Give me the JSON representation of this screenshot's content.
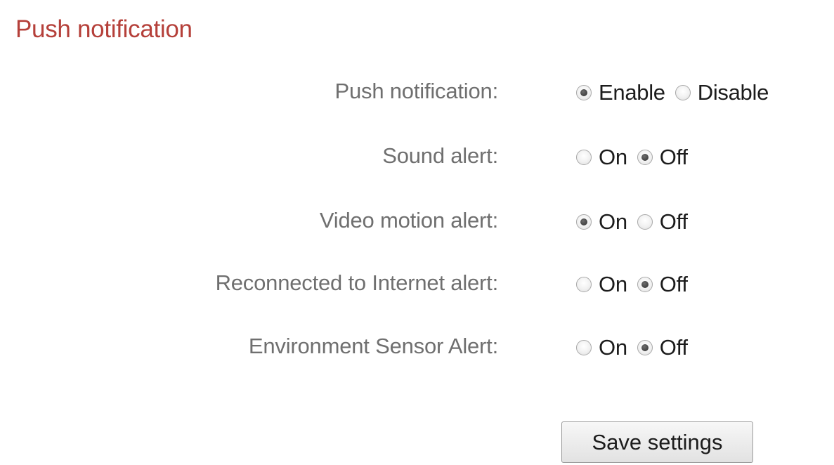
{
  "section_title": "Push notification",
  "settings": [
    {
      "label": "Push notification:",
      "options": [
        {
          "label": "Enable",
          "checked": true
        },
        {
          "label": "Disable",
          "checked": false
        }
      ]
    },
    {
      "label": "Sound alert:",
      "options": [
        {
          "label": "On",
          "checked": false
        },
        {
          "label": "Off",
          "checked": true
        }
      ]
    },
    {
      "label": "Video motion alert:",
      "options": [
        {
          "label": "On",
          "checked": true
        },
        {
          "label": "Off",
          "checked": false
        }
      ]
    },
    {
      "label": "Reconnected to Internet alert:",
      "options": [
        {
          "label": "On",
          "checked": false
        },
        {
          "label": "Off",
          "checked": true
        }
      ]
    },
    {
      "label": "Environment Sensor Alert:",
      "options": [
        {
          "label": "On",
          "checked": false
        },
        {
          "label": "Off",
          "checked": true
        }
      ]
    }
  ],
  "save_button_label": "Save settings",
  "colors": {
    "title": "#b5403a",
    "label": "#6f6f6f",
    "text": "#1c1c1c"
  }
}
